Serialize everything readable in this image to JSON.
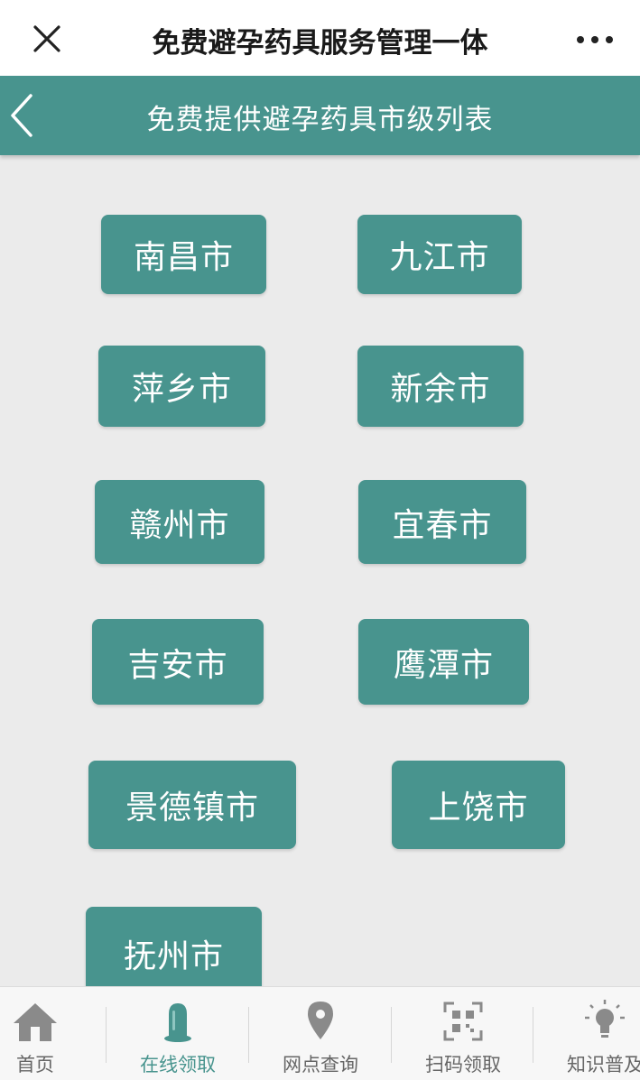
{
  "topbar": {
    "title": "免费避孕药具服务管理一体",
    "close_icon": "close-icon",
    "more_icon": "more-dots-icon"
  },
  "header": {
    "title": "免费提供避孕药具市级列表",
    "back_icon": "chevron-left-icon",
    "color": "#48948e"
  },
  "cities": [
    {
      "name": "南昌市"
    },
    {
      "name": "九江市"
    },
    {
      "name": "萍乡市"
    },
    {
      "name": "新余市"
    },
    {
      "name": "赣州市"
    },
    {
      "name": "宜春市"
    },
    {
      "name": "吉安市"
    },
    {
      "name": "鹰潭市"
    },
    {
      "name": "景德镇市"
    },
    {
      "name": "上饶市"
    },
    {
      "name": "抚州市"
    }
  ],
  "tabs": [
    {
      "label": "首页",
      "icon": "home-icon",
      "active": false
    },
    {
      "label": "在线领取",
      "icon": "condom-icon",
      "active": true
    },
    {
      "label": "网点查询",
      "icon": "location-pin-icon",
      "active": false
    },
    {
      "label": "扫码领取",
      "icon": "qr-scan-icon",
      "active": false
    },
    {
      "label": "知识普及",
      "icon": "lightbulb-icon",
      "active": false
    }
  ],
  "colors": {
    "accent": "#48948e",
    "background": "#ebebeb",
    "tab_inactive": "#666666"
  }
}
